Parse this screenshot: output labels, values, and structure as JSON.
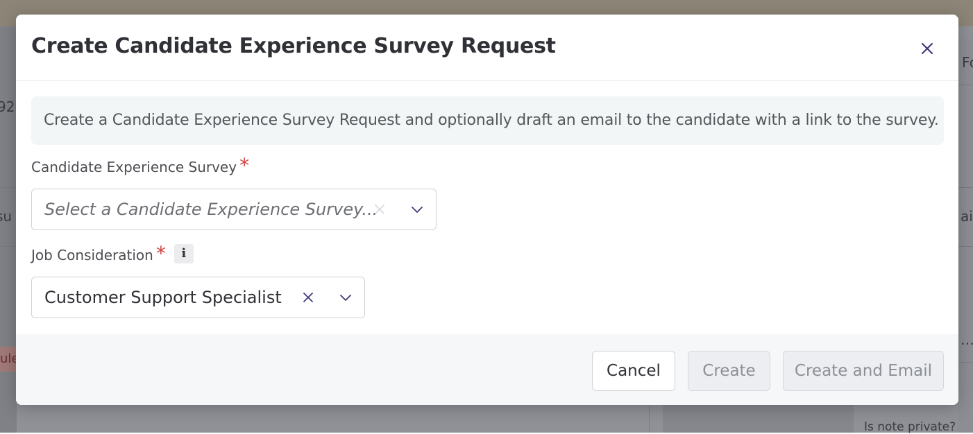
{
  "background": {
    "fragments": {
      "left_top": "92",
      "left_mid": "su",
      "left_badge": "ule",
      "right_top": "Fo",
      "right_mid": "ai",
      "right_ellipsis": "…",
      "bottom_right": "Is note private?"
    }
  },
  "modal": {
    "title": "Create Candidate Experience Survey Request",
    "close_icon": "close-icon",
    "info_text": "Create a Candidate Experience Survey Request and optionally draft an email to the candidate with a link to the survey.",
    "survey_field": {
      "label": "Candidate Experience Survey",
      "required_mark": "*",
      "placeholder": "Select a Candidate Experience Survey...",
      "value": ""
    },
    "job_field": {
      "label": "Job Consideration",
      "required_mark": "*",
      "info_glyph": "i",
      "value": "Customer Support Specialist"
    },
    "buttons": {
      "cancel": "Cancel",
      "create": "Create",
      "create_and_email": "Create and Email"
    }
  },
  "colors": {
    "required": "#d14343",
    "accent_icon": "#3d3a7a",
    "disabled_text": "#8c8f95"
  }
}
